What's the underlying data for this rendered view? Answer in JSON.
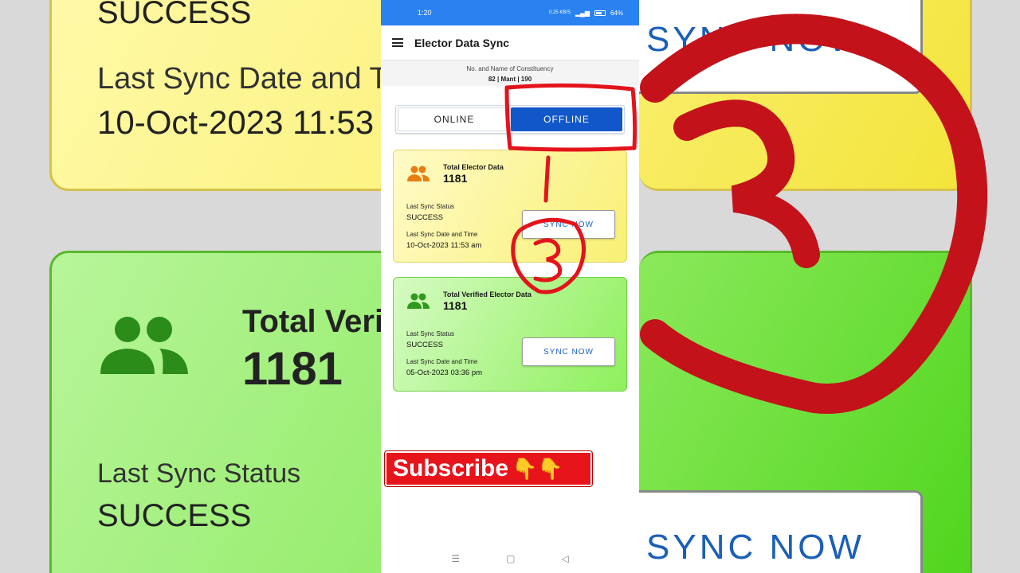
{
  "background": {
    "left": {
      "status_value": "SUCCESS",
      "date_label": "Last Sync Date and Ti",
      "date_value": "10-Oct-2023 11:53",
      "verified_title": "Total Veri",
      "verified_count": "1181",
      "status_label": "Last Sync Status",
      "status_value2": "SUCCESS"
    },
    "right": {
      "sync_top": "SYNC NOW",
      "sync_bottom": "SYNC NOW"
    }
  },
  "statusbar": {
    "time": "1:20",
    "signal": "0.25 KB/S",
    "battery": "64%"
  },
  "appbar": {
    "title": "Elector Data Sync"
  },
  "constituency": {
    "label": "No. and Name of Constituency",
    "value": "82 | Mant | 190"
  },
  "toggle": {
    "online": "ONLINE",
    "offline": "OFFLINE",
    "selected": "OFFLINE"
  },
  "cards": [
    {
      "title": "Total Elector Data",
      "count": "1181",
      "status_label": "Last Sync Status",
      "status_value": "SUCCESS",
      "date_label": "Last Sync Date and Time",
      "date_value": "10-Oct-2023 11:53 am",
      "button": "SYNC NOW",
      "icon": "people-icon",
      "icon_color": "#e97d12"
    },
    {
      "title": "Total Verified Elector Data",
      "count": "1181",
      "status_label": "Last Sync Status",
      "status_value": "SUCCESS",
      "date_label": "Last Sync Date and Time",
      "date_value": "05-Oct-2023 03:36 pm",
      "button": "SYNC NOW",
      "icon": "people-icon",
      "icon_color": "#2f9a1e"
    }
  ],
  "overlay": {
    "subscribe": "Subscribe",
    "hand": "👇👇"
  },
  "colors": {
    "accent": "#1257c9",
    "statusbar": "#2a82f0",
    "annotation": "#e3131c",
    "subscribe": "#e8141c"
  }
}
